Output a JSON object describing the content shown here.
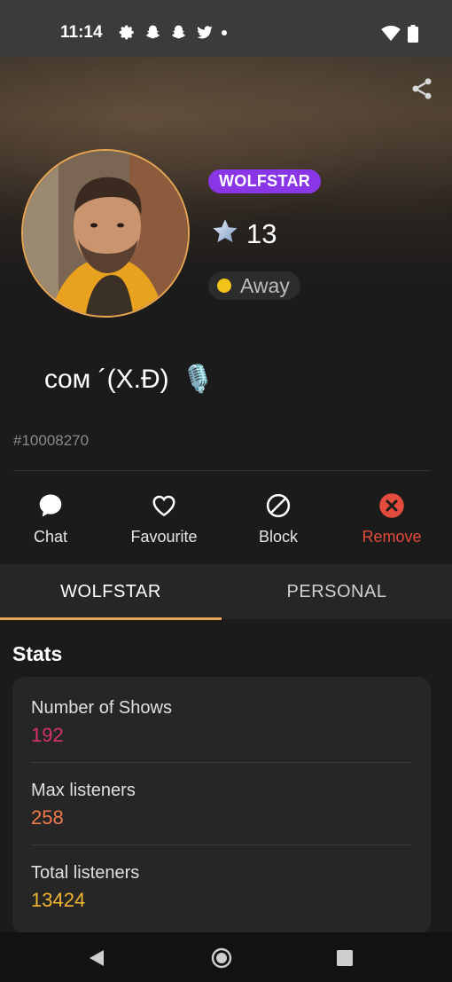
{
  "status_bar": {
    "time": "11:14",
    "icons": [
      "gear-icon",
      "snapchat-icon",
      "snapchat-icon",
      "twitter-icon",
      "dot-icon"
    ],
    "right_icons": [
      "wifi-icon",
      "battery-icon"
    ]
  },
  "profile": {
    "role_badge": "WOLFSTAR",
    "star_count": "13",
    "status": "Away",
    "status_color": "#f2c318",
    "username": "ᴄᴏᴍ ´(X.Ɖ)",
    "username_emoji": "🎙️",
    "user_id": "#10008270"
  },
  "actions": [
    {
      "label": "Chat",
      "icon": "chat-bubble-icon"
    },
    {
      "label": "Favourite",
      "icon": "heart-icon"
    },
    {
      "label": "Block",
      "icon": "block-icon"
    },
    {
      "label": "Remove",
      "icon": "remove-icon"
    }
  ],
  "tabs": [
    {
      "label": "WOLFSTAR",
      "active": true
    },
    {
      "label": "PERSONAL",
      "active": false
    }
  ],
  "stats": {
    "title": "Stats",
    "items": [
      {
        "label": "Number of Shows",
        "value": "192",
        "color": "#d6336c"
      },
      {
        "label": "Max listeners",
        "value": "258",
        "color": "#f07a4a"
      },
      {
        "label": "Total listeners",
        "value": "13424",
        "color": "#f2b631"
      }
    ]
  },
  "colors": {
    "accent": "#e8a552",
    "badge": "#8a35e6",
    "remove": "#e34b3c"
  }
}
